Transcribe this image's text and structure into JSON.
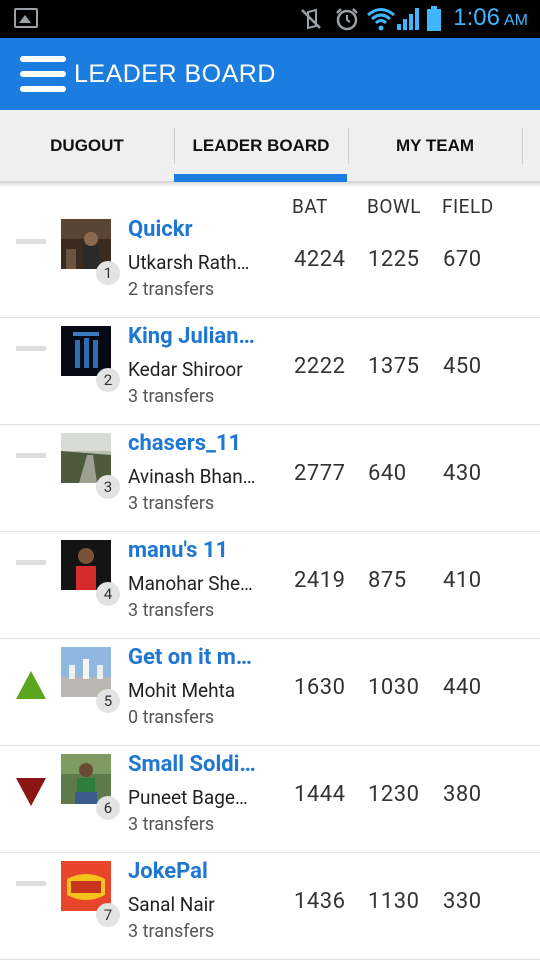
{
  "status": {
    "time": "1:06",
    "ampm": "AM"
  },
  "appbar": {
    "title": "LEADER BOARD"
  },
  "tabs": [
    {
      "label": "DUGOUT"
    },
    {
      "label": "LEADER BOARD",
      "selected": true
    },
    {
      "label": "MY TEAM"
    }
  ],
  "columns": {
    "bat": "BAT",
    "bowl": "BOWL",
    "field": "FIELD"
  },
  "colors": {
    "primary": "#1c7de0",
    "team_name": "#1f77d4",
    "up": "#5aa71d",
    "down": "#8b1515"
  },
  "rows": [
    {
      "rank": "1",
      "team": "Quickr",
      "owner": "Utkarsh Rath…",
      "transfers": "2 transfers",
      "bat": "4224",
      "bowl": "1225",
      "field": "670",
      "trend": "same"
    },
    {
      "rank": "2",
      "team": "King Julian…",
      "owner": "Kedar Shiroor",
      "transfers": "3 transfers",
      "bat": "2222",
      "bowl": "1375",
      "field": "450",
      "trend": "same"
    },
    {
      "rank": "3",
      "team": "chasers_11",
      "owner": "Avinash Bhan…",
      "transfers": "3 transfers",
      "bat": "2777",
      "bowl": "640",
      "field": "430",
      "trend": "same"
    },
    {
      "rank": "4",
      "team": "manu's 11",
      "owner": "Manohar She…",
      "transfers": "3 transfers",
      "bat": "2419",
      "bowl": "875",
      "field": "410",
      "trend": "same"
    },
    {
      "rank": "5",
      "team": "Get on it m…",
      "owner": "Mohit Mehta",
      "transfers": "0 transfers",
      "bat": "1630",
      "bowl": "1030",
      "field": "440",
      "trend": "up"
    },
    {
      "rank": "6",
      "team": "Small Soldi…",
      "owner": "Puneet Bage…",
      "transfers": "3 transfers",
      "bat": "1444",
      "bowl": "1230",
      "field": "380",
      "trend": "down"
    },
    {
      "rank": "7",
      "team": "JokePal",
      "owner": "Sanal Nair",
      "transfers": "3 transfers",
      "bat": "1436",
      "bowl": "1130",
      "field": "330",
      "trend": "same"
    }
  ]
}
